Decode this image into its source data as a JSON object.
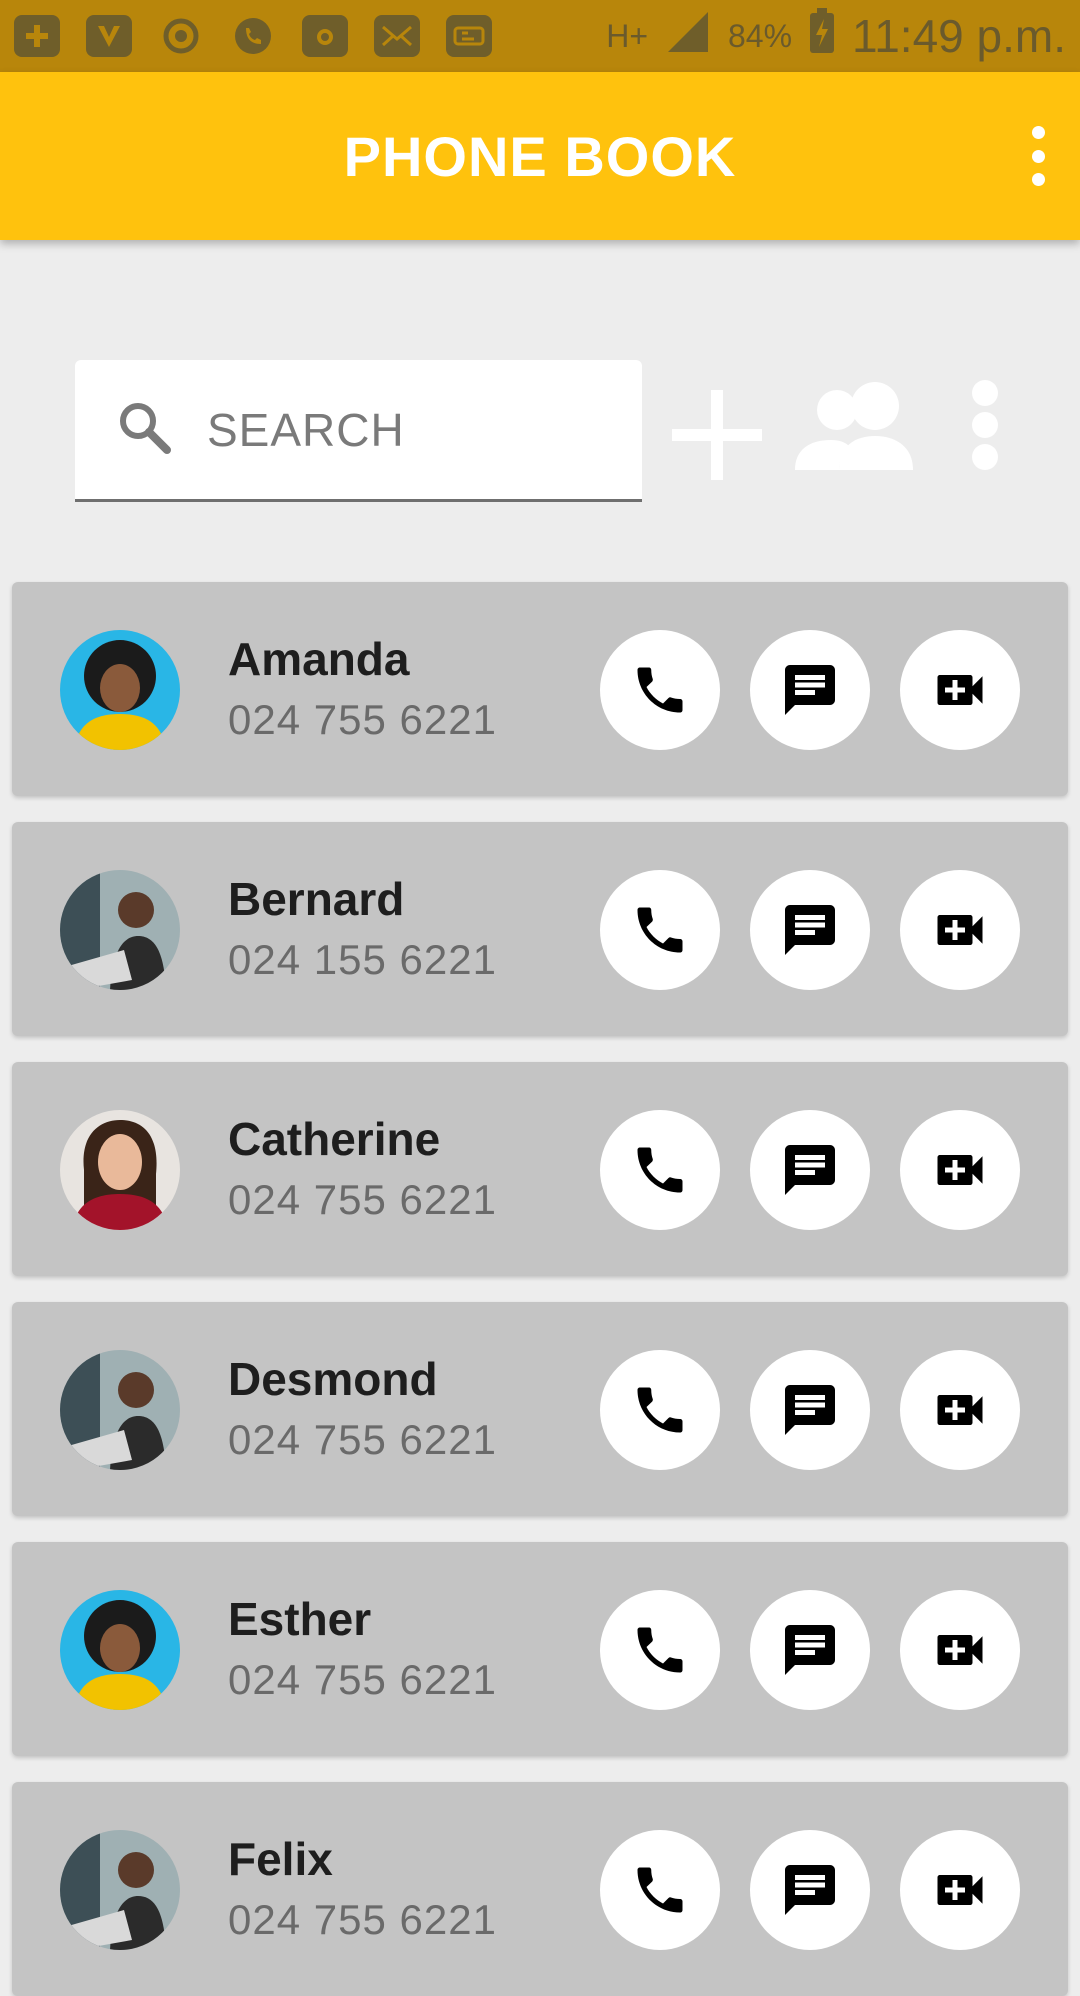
{
  "status_bar": {
    "battery": "84%",
    "network": "H+",
    "time": "11:49 p.m."
  },
  "app_bar": {
    "title": "PHONE BOOK"
  },
  "search": {
    "placeholder": "SEARCH"
  },
  "colors": {
    "accent": "#ffc20d",
    "status_bar": "#b8860b",
    "card_background": "#c4c4c4"
  },
  "contacts": [
    {
      "name": "Amanda",
      "phone": "024 755 6221",
      "avatar": "woman-curly-hair-yellow"
    },
    {
      "name": "Bernard",
      "phone": "024 155 6221",
      "avatar": "man-laptop"
    },
    {
      "name": "Catherine",
      "phone": "024 755 6221",
      "avatar": "woman-red-top"
    },
    {
      "name": "Desmond",
      "phone": "024 755 6221",
      "avatar": "man-laptop"
    },
    {
      "name": "Esther",
      "phone": "024 755 6221",
      "avatar": "woman-curly-hair-yellow"
    },
    {
      "name": "Felix",
      "phone": "024 755 6221",
      "avatar": "man-laptop"
    }
  ]
}
